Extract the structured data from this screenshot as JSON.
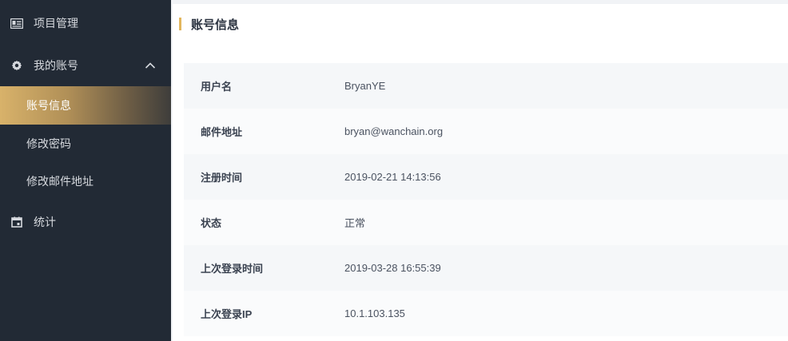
{
  "sidebar": {
    "items": [
      {
        "label": "项目管理",
        "icon": "id-card-icon"
      },
      {
        "label": "我的账号",
        "icon": "gear-icon",
        "expanded": true,
        "children": [
          {
            "label": "账号信息",
            "active": true
          },
          {
            "label": "修改密码"
          },
          {
            "label": "修改邮件地址"
          }
        ]
      },
      {
        "label": "统计",
        "icon": "calendar-icon"
      }
    ]
  },
  "main": {
    "title": "账号信息",
    "rows": [
      {
        "key": "用户名",
        "value": "BryanYE"
      },
      {
        "key": "邮件地址",
        "value": "bryan@wanchain.org"
      },
      {
        "key": "注册时间",
        "value": "2019-02-21 14:13:56"
      },
      {
        "key": "状态",
        "value": "正常"
      },
      {
        "key": "上次登录时间",
        "value": "2019-03-28 16:55:39"
      },
      {
        "key": "上次登录IP",
        "value": "10.1.103.135"
      }
    ]
  },
  "colors": {
    "sidebar_bg": "#222a35",
    "accent": "#e2b65d",
    "active_gradient_start": "#d8b26a"
  }
}
